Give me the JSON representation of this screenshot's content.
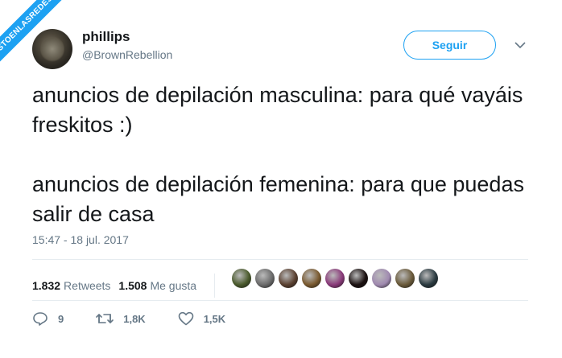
{
  "watermark": {
    "text": "VISTOENLASREDES"
  },
  "user": {
    "name": "phillips",
    "handle": "@BrownRebellion"
  },
  "follow_button": {
    "label": "Seguir"
  },
  "tweet": {
    "paragraphs": [
      "anuncios de depilación masculina: para qué vayáis freskitos :)",
      "anuncios de depilación femenina: para que puedas salir de casa"
    ],
    "timestamp": "15:47 - 18 jul. 2017"
  },
  "stats": {
    "retweets_count": "1.832",
    "retweets_label": "Retweets",
    "likes_count": "1.508",
    "likes_label": "Me gusta"
  },
  "likers": [
    {
      "color": "#4a5a2c"
    },
    {
      "color": "#6b6b6b"
    },
    {
      "color": "#5a4030"
    },
    {
      "color": "#7a5a30"
    },
    {
      "color": "#8a3a7a"
    },
    {
      "color": "#1a1010"
    },
    {
      "color": "#a08ab0"
    },
    {
      "color": "#6a5a3a"
    },
    {
      "color": "#2a3a40"
    }
  ],
  "actions": {
    "replies": "9",
    "retweets": "1,8K",
    "likes": "1,5K"
  },
  "colors": {
    "accent": "#1da1f2",
    "text": "#14171a",
    "secondary": "#657786"
  }
}
